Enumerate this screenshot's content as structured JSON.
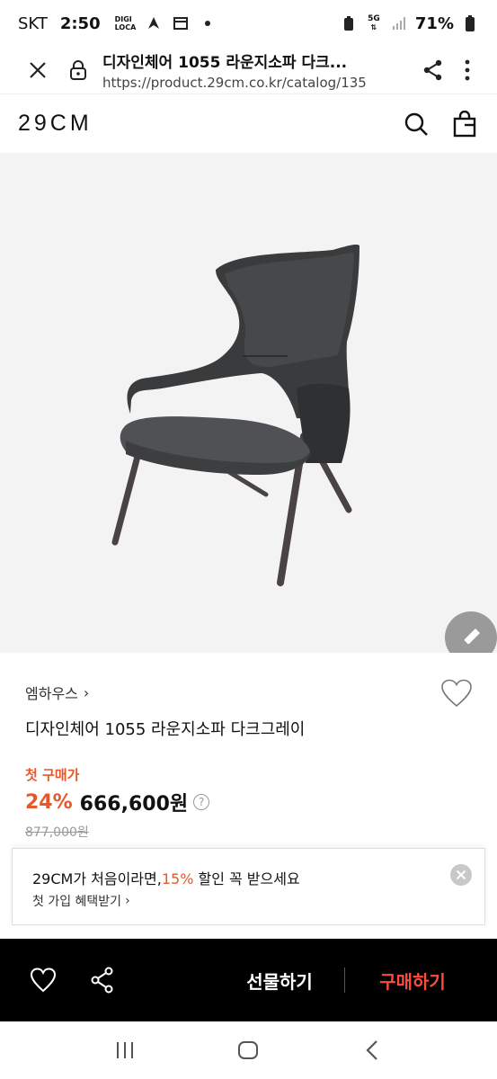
{
  "status_bar": {
    "carrier": "SKT",
    "time": "2:50",
    "digi_line1": "DIGI",
    "digi_line2": "LOCA",
    "network": "5G",
    "battery": "71%"
  },
  "browser": {
    "title": "디자인체어 1055 라운지소파 다크...",
    "url": "https://product.29cm.co.kr/catalog/135",
    "icons": [
      "close-icon",
      "lock-icon",
      "share-icon",
      "more-vert-icon"
    ]
  },
  "header": {
    "logo": "29CM",
    "icons": [
      "search-icon",
      "shopping-bag-icon"
    ]
  },
  "product": {
    "brand": "엠하우스",
    "brand_chevron": "›",
    "title": "디자인체어 1055 라운지소파 다크그레이",
    "first_purchase_label": "첫 구매가",
    "discount": "24%",
    "price": "666,600원",
    "help": "?",
    "original_price": "877,000원"
  },
  "promo": {
    "main_prefix": "29CM가 처음이라면,",
    "main_highlight": "15%",
    "main_suffix": " 할인 꼭 받으세요",
    "sub": "첫 가입 혜택받기",
    "sub_chevron": "›"
  },
  "action_bar": {
    "gift_label": "선물하기",
    "buy_label": "구매하기",
    "icons": [
      "heart-icon",
      "share-icon"
    ]
  },
  "colors": {
    "accent": "#e8572a",
    "buy": "#ff4b3a",
    "bar_bg": "#000000"
  }
}
